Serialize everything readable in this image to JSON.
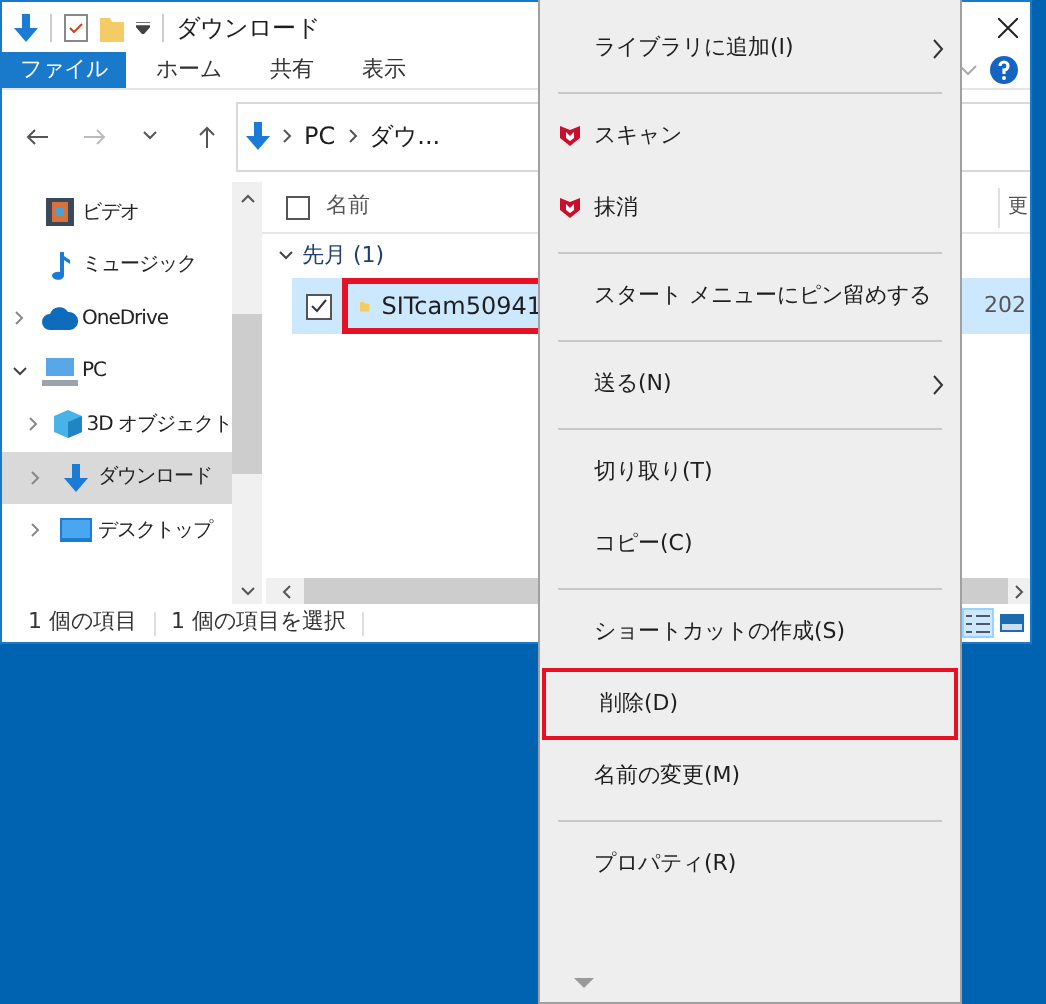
{
  "window": {
    "title": "ダウンロード"
  },
  "ribbon_tabs": [
    {
      "label": "ファイル",
      "selected": true
    },
    {
      "label": "ホーム",
      "selected": false
    },
    {
      "label": "共有",
      "selected": false
    },
    {
      "label": "表示",
      "selected": false
    }
  ],
  "address": {
    "path": [
      "PC",
      "ダウ..."
    ]
  },
  "nav_items": [
    {
      "kind": "video",
      "label": "ビデオ",
      "selected": false
    },
    {
      "kind": "music",
      "label": "ミュージック",
      "selected": false
    },
    {
      "kind": "cloud",
      "label": "OneDrive",
      "selected": false,
      "expanded": false
    },
    {
      "kind": "pc",
      "label": "PC",
      "selected": false,
      "expanded": true,
      "children": [
        {
          "kind": "cube",
          "label": "3D オブジェクト",
          "selected": false,
          "expanded": false
        },
        {
          "kind": "download",
          "label": "ダウンロード",
          "selected": true,
          "expanded": false
        },
        {
          "kind": "desktop",
          "label": "デスクトップ",
          "selected": false,
          "expanded": false
        }
      ]
    }
  ],
  "select_all": {
    "checked": false
  },
  "columns": [
    {
      "label": "名前"
    },
    {
      "label": "更"
    }
  ],
  "group": {
    "label": "先月 (1)",
    "expanded": true
  },
  "files": [
    {
      "name": "SITcam50941",
      "date": "202",
      "checked": true,
      "selected": true,
      "highlighted": true
    }
  ],
  "status_bar": [
    "1 個の項目",
    "1 個の項目を選択"
  ],
  "view_buttons": [
    {
      "kind": "details",
      "selected": true
    },
    {
      "kind": "tiles",
      "selected": false
    }
  ],
  "context_menu": {
    "items": [
      {
        "kind": "item",
        "label": "ライブラリに追加(I)",
        "submenu": true,
        "highlighted": false
      },
      {
        "kind": "separator"
      },
      {
        "kind": "shield_item",
        "label": "スキャン",
        "submenu": false,
        "highlighted": false
      },
      {
        "kind": "shield_item",
        "label": "抹消",
        "submenu": false,
        "highlighted": false
      },
      {
        "kind": "separator"
      },
      {
        "kind": "item",
        "label": "スタート メニューにピン留めする",
        "submenu": false,
        "highlighted": false
      },
      {
        "kind": "separator"
      },
      {
        "kind": "item",
        "label": "送る(N)",
        "submenu": true,
        "highlighted": false
      },
      {
        "kind": "separator"
      },
      {
        "kind": "item",
        "label": "切り取り(T)",
        "submenu": false,
        "highlighted": false
      },
      {
        "kind": "item",
        "label": "コピー(C)",
        "submenu": false,
        "highlighted": false
      },
      {
        "kind": "separator"
      },
      {
        "kind": "item",
        "label": "ショートカットの作成(S)",
        "submenu": false,
        "highlighted": false
      },
      {
        "kind": "item",
        "label": "削除(D)",
        "submenu": false,
        "highlighted": true
      },
      {
        "kind": "item",
        "label": "名前の変更(M)",
        "submenu": false,
        "highlighted": false
      },
      {
        "kind": "separator"
      },
      {
        "kind": "item",
        "label": "プロパティ(R)",
        "submenu": false,
        "highlighted": false
      }
    ]
  }
}
